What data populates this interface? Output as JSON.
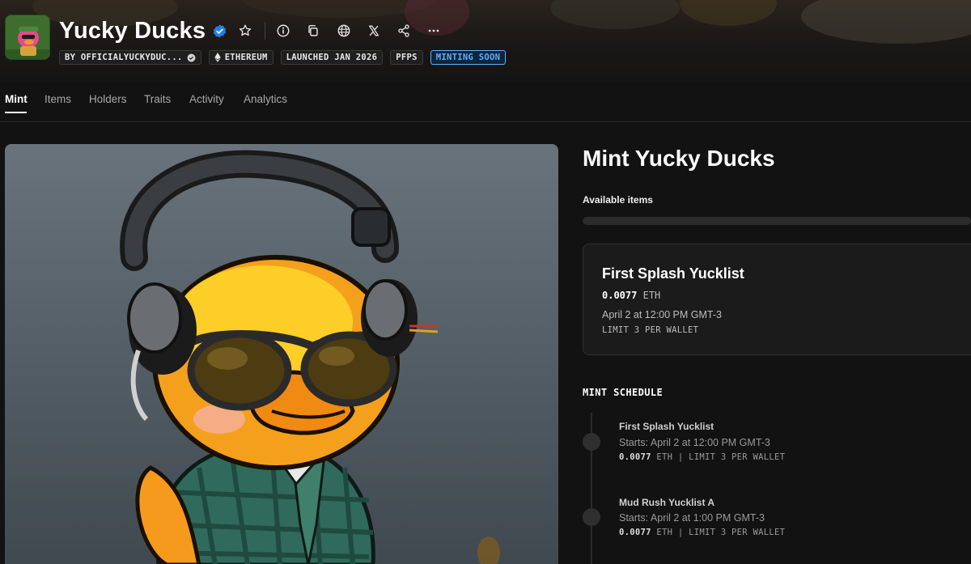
{
  "collection": {
    "name": "Yucky Ducks",
    "badges": {
      "creator": "BY OFFICIALYUCKYDUC...",
      "chain": "ETHEREUM",
      "launched": "LAUNCHED JAN 2026",
      "category": "PFPS",
      "status": "MINTING SOON"
    }
  },
  "header_icons": [
    "verified-icon",
    "star-icon",
    "info-icon",
    "copy-icon",
    "globe-icon",
    "x-icon",
    "share-icon",
    "more-icon"
  ],
  "tabs": [
    {
      "label": "Mint",
      "active": true
    },
    {
      "label": "Items"
    },
    {
      "label": "Holders"
    },
    {
      "label": "Traits"
    },
    {
      "label": "Activity"
    },
    {
      "label": "Analytics"
    }
  ],
  "mint": {
    "title": "Mint Yucky Ducks",
    "available_label": "Available items",
    "available_fraction": 0.0,
    "active_stage": {
      "name": "First Splash Yucklist",
      "price": "0.0077",
      "currency": "ETH",
      "time": "April 2 at 12:00 PM GMT-3",
      "limit": "LIMIT 3 PER WALLET"
    },
    "schedule_title": "MINT SCHEDULE",
    "schedule": [
      {
        "name": "First Splash Yucklist",
        "start": "Starts: April 2 at 12:00 PM GMT-3",
        "price": "0.0077",
        "rest": "ETH | LIMIT 3 PER WALLET"
      },
      {
        "name": "Mud Rush Yucklist A",
        "start": "Starts: April 2 at 1:00 PM GMT-3",
        "price": "0.0077",
        "rest": "ETH | LIMIT 3 PER WALLET"
      }
    ]
  },
  "colors": {
    "accent": "#5ab2ff",
    "verified": "#2081e2",
    "background": "#121212"
  }
}
